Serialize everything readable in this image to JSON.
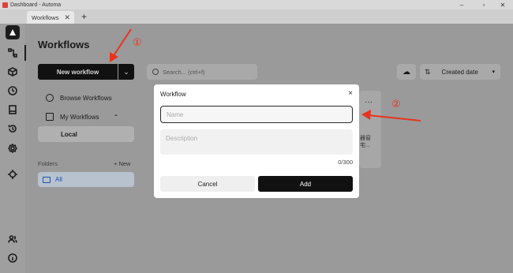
{
  "window": {
    "title": "Dashboard - Automa",
    "minimize": "–",
    "maximize": "▫",
    "close": "✕"
  },
  "tabs": [
    {
      "label": "Workflows",
      "close": "✕"
    }
  ],
  "new_tab": "+",
  "sidebar": {
    "icons": [
      "workflows-icon",
      "packages-icon",
      "schedule-icon",
      "storage-icon",
      "history-icon",
      "settings-icon",
      "recording-icon",
      "team-icon",
      "about-icon"
    ]
  },
  "main": {
    "title": "Workflows",
    "new_workflow_label": "New workflow",
    "dropdown_glyph": "⌄",
    "nav": {
      "browse": "Browse Workflows",
      "my_workflows": "My Workflows",
      "collapse_glyph": "⌃",
      "local": "Local"
    },
    "folders_label": "Folders",
    "new_folder_label": "+ New",
    "all_label": "All",
    "search_placeholder": "Search... (ctrl+f)",
    "sort_label": "Created date",
    "card_menu": "···",
    "card_text": [
      "器窗",
      "宅..."
    ]
  },
  "modal": {
    "title": "Workflow",
    "close": "×",
    "name_placeholder": "Name",
    "description_placeholder": "Description",
    "counter": "0/300",
    "cancel_label": "Cancel",
    "add_label": "Add"
  },
  "annotations": {
    "one": "①",
    "two": "②"
  },
  "colors": {
    "annotation": "#e8331f",
    "primary": "#111111",
    "overlay": "#8a8a8a"
  }
}
